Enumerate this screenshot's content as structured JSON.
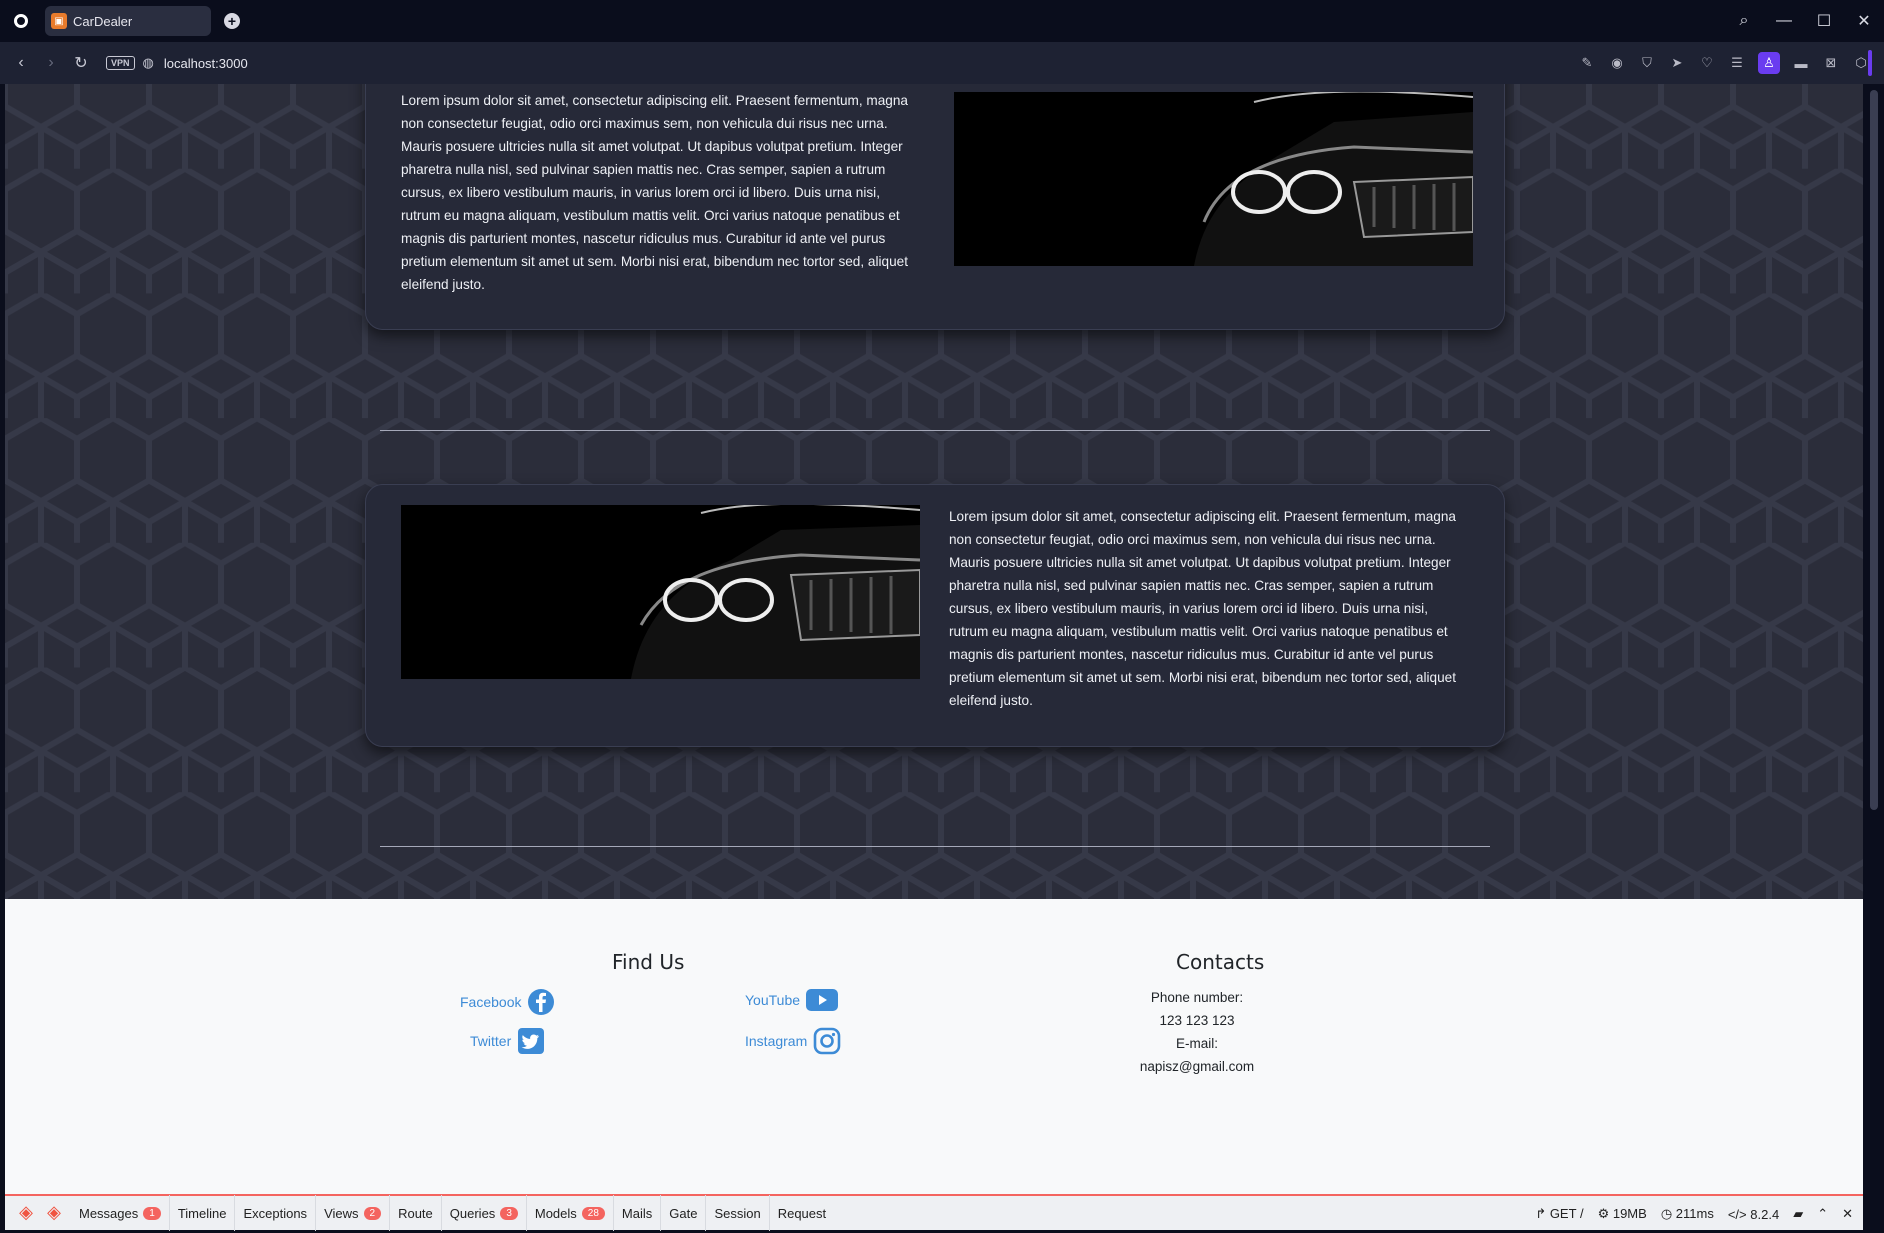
{
  "browser": {
    "tab_title": "CarDealer",
    "url": "localhost:3000",
    "vpn_label": "VPN"
  },
  "cards": [
    {
      "text": "Lorem ipsum dolor sit amet, consectetur adipiscing elit. Praesent fermentum, magna non consectetur feugiat, odio orci maximus sem, non vehicula dui risus nec urna. Mauris posuere ultricies nulla sit amet volutpat. Ut dapibus volutpat pretium. Integer pharetra nulla nisl, sed pulvinar sapien mattis nec. Cras semper, sapien a rutrum cursus, ex libero vestibulum mauris, in varius lorem orci id libero. Duis urna nisi, rutrum eu magna aliquam, vestibulum mattis velit. Orci varius natoque penatibus et magnis dis parturient montes, nascetur ridiculus mus. Curabitur id ante vel purus pretium elementum sit amet ut sem. Morbi nisi erat, bibendum nec tortor sed, aliquet eleifend justo."
    },
    {
      "text": "Lorem ipsum dolor sit amet, consectetur adipiscing elit. Praesent fermentum, magna non consectetur feugiat, odio orci maximus sem, non vehicula dui risus nec urna. Mauris posuere ultricies nulla sit amet volutpat. Ut dapibus volutpat pretium. Integer pharetra nulla nisl, sed pulvinar sapien mattis nec. Cras semper, sapien a rutrum cursus, ex libero vestibulum mauris, in varius lorem orci id libero. Duis urna nisi, rutrum eu magna aliquam, vestibulum mattis velit. Orci varius natoque penatibus et magnis dis parturient montes, nascetur ridiculus mus. Curabitur id ante vel purus pretium elementum sit amet ut sem. Morbi nisi erat, bibendum nec tortor sed, aliquet eleifend justo."
    }
  ],
  "footer": {
    "find_us_title": "Find Us",
    "social": {
      "facebook": "Facebook",
      "youtube": "YouTube",
      "twitter": "Twitter",
      "instagram": "Instagram"
    },
    "contacts_title": "Contacts",
    "phone_label": "Phone number:",
    "phone": "123 123 123",
    "email_label": "E-mail:",
    "email": "napisz@gmail.com"
  },
  "debugbar": {
    "items": [
      {
        "label": "Messages",
        "badge": "1"
      },
      {
        "label": "Timeline",
        "badge": ""
      },
      {
        "label": "Exceptions",
        "badge": ""
      },
      {
        "label": "Views",
        "badge": "2"
      },
      {
        "label": "Route",
        "badge": ""
      },
      {
        "label": "Queries",
        "badge": "3"
      },
      {
        "label": "Models",
        "badge": "28"
      },
      {
        "label": "Mails",
        "badge": ""
      },
      {
        "label": "Gate",
        "badge": ""
      },
      {
        "label": "Session",
        "badge": ""
      },
      {
        "label": "Request",
        "badge": ""
      }
    ],
    "method": "GET",
    "route": "/",
    "memory": "19MB",
    "time": "211ms",
    "php_version": "8.2.4"
  },
  "colors": {
    "accent_purple": "#6a3cf0",
    "link_blue": "#3d8bd6",
    "debug_red": "#f4645f"
  }
}
